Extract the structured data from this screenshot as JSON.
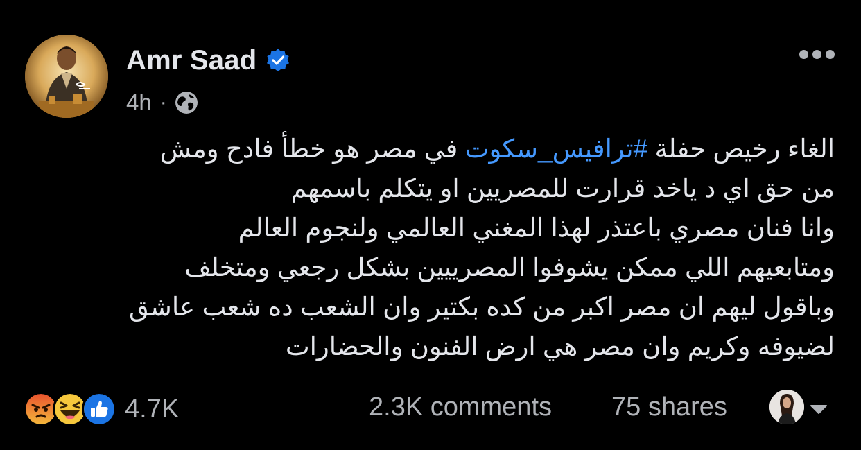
{
  "post": {
    "author": "Amr Saad",
    "verified_icon": "verified-badge-icon",
    "timestamp": "4h",
    "separator": "·",
    "audience_icon": "globe-icon",
    "more_icon": "more-options-icon",
    "text_lines": [
      {
        "before": "الغاء رخيص حفلة ",
        "hashtag": "#ترافيس_سكوت",
        "after": " في مصر هو خطأ فادح ومش"
      },
      {
        "text": "من حق اي د ياخد قرارت للمصريين او يتكلم باسمهم"
      },
      {
        "text": "وانا فنان مصري باعتذر لهذا المغني العالمي ولنجوم العالم"
      },
      {
        "text": "ومتابعيهم اللي ممكن يشوفوا المصرييين بشكل رجعي ومتخلف"
      },
      {
        "text": "وباقول ليهم ان مصر اكبر من كده بكتير وان الشعب ده شعب عاشق"
      },
      {
        "text": "لضيوفه وكريم وان مصر هي ارض الفنون والحضارات"
      }
    ]
  },
  "footer": {
    "reactions": [
      "angry-reaction-icon",
      "haha-reaction-icon",
      "like-reaction-icon"
    ],
    "reaction_count": "4.7K",
    "comments": "2.3K comments",
    "shares": "75 shares",
    "viewer_icon": "viewer-avatar",
    "dropdown_icon": "caret-down-icon"
  },
  "colors": {
    "background": "#000000",
    "text": "#e4e6eb",
    "secondary_text": "#b0b3b8",
    "hashtag": "#4599ff",
    "verified": "#1b74e4"
  }
}
